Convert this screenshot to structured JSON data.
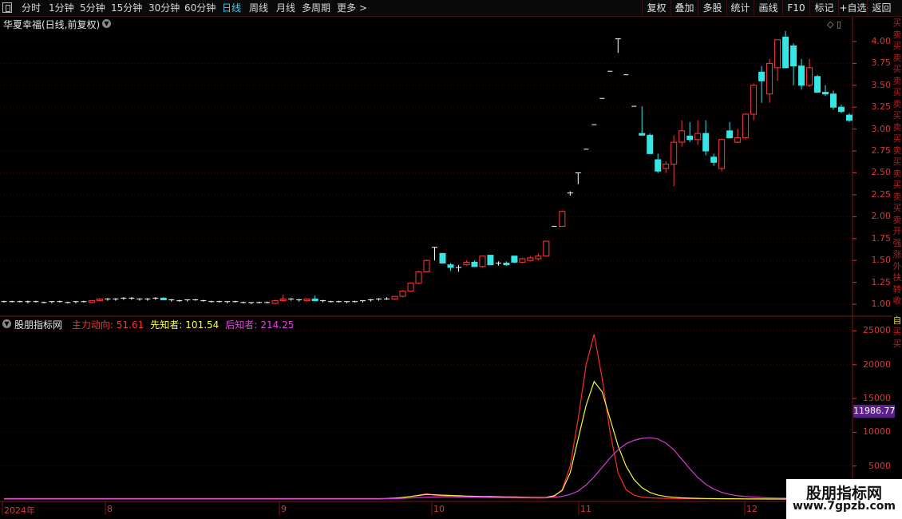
{
  "toolbar": {
    "periods": [
      "分时",
      "1分钟",
      "5分钟",
      "15分钟",
      "30分钟",
      "60分钟",
      "日线",
      "周线",
      "月线",
      "多周期",
      "更多 >"
    ],
    "active_period": "日线",
    "right_buttons": [
      "复权",
      "叠加",
      "多股",
      "统计",
      "画线",
      "F10",
      "标记",
      "+自选",
      "返回"
    ]
  },
  "stock": {
    "title": "华夏幸福(日线,前复权)"
  },
  "price_axis": {
    "ticks": [
      "4.00",
      "3.75",
      "3.50",
      "3.25",
      "3.00",
      "2.75",
      "2.50",
      "2.25",
      "2.00",
      "1.75",
      "1.50",
      "1.25",
      "1.00"
    ]
  },
  "indicator": {
    "name": "股朋指标网",
    "lines": [
      {
        "label": "主力动向:",
        "value": "51.61",
        "color": "#ff3030"
      },
      {
        "label": "先知者:",
        "value": "101.54",
        "color": "#ffff40"
      },
      {
        "label": "后知者:",
        "value": "214.25",
        "color": "#e040e0"
      }
    ],
    "axis_ticks": [
      "25000",
      "20000",
      "15000",
      "10000",
      "5000"
    ],
    "current_value": "11986.77"
  },
  "x_axis": {
    "labels": [
      "2024年",
      "8",
      "9",
      "10",
      "11",
      "12"
    ]
  },
  "right_strip": {
    "chars": "买卖买卖买卖买卖买卖买卖买卖买卖买卖开强涨外扶转收",
    "chars2": "自买买"
  },
  "watermark": {
    "title": "股朋指标网",
    "url": "www.7gpzb.com"
  },
  "colors": {
    "up": "#ff3b3b",
    "down": "#35e6e6",
    "grid": "#3a1010",
    "axis": "#d63a3a"
  },
  "chart_data": {
    "type": "candlestick",
    "title": "华夏幸福(日线,前复权)",
    "ylim": [
      0.9,
      4.2
    ],
    "ohlc": [
      [
        1.03,
        1.04,
        1.02,
        1.03
      ],
      [
        1.03,
        1.04,
        1.02,
        1.03
      ],
      [
        1.03,
        1.04,
        1.02,
        1.02
      ],
      [
        1.02,
        1.04,
        1.01,
        1.03
      ],
      [
        1.03,
        1.04,
        1.02,
        1.02
      ],
      [
        1.02,
        1.03,
        1.01,
        1.02
      ],
      [
        1.02,
        1.03,
        1.01,
        1.03
      ],
      [
        1.03,
        1.04,
        1.02,
        1.02
      ],
      [
        1.02,
        1.03,
        1.01,
        1.02
      ],
      [
        1.02,
        1.03,
        1.01,
        1.03
      ],
      [
        1.03,
        1.04,
        1.02,
        1.02
      ],
      [
        1.02,
        1.04,
        1.01,
        1.04
      ],
      [
        1.04,
        1.06,
        1.03,
        1.06
      ],
      [
        1.06,
        1.07,
        1.04,
        1.05
      ],
      [
        1.05,
        1.07,
        1.04,
        1.06
      ],
      [
        1.06,
        1.08,
        1.05,
        1.07
      ],
      [
        1.07,
        1.08,
        1.05,
        1.06
      ],
      [
        1.06,
        1.07,
        1.04,
        1.05
      ],
      [
        1.05,
        1.07,
        1.04,
        1.06
      ],
      [
        1.06,
        1.08,
        1.05,
        1.07
      ],
      [
        1.07,
        1.08,
        1.05,
        1.05
      ],
      [
        1.05,
        1.06,
        1.03,
        1.04
      ],
      [
        1.04,
        1.05,
        1.03,
        1.04
      ],
      [
        1.04,
        1.05,
        1.03,
        1.05
      ],
      [
        1.05,
        1.06,
        1.04,
        1.04
      ],
      [
        1.04,
        1.05,
        1.03,
        1.03
      ],
      [
        1.03,
        1.04,
        1.02,
        1.03
      ],
      [
        1.03,
        1.04,
        1.02,
        1.02
      ],
      [
        1.02,
        1.03,
        1.01,
        1.03
      ],
      [
        1.03,
        1.04,
        1.02,
        1.02
      ],
      [
        1.02,
        1.03,
        1.01,
        1.01
      ],
      [
        1.01,
        1.02,
        1.0,
        1.02
      ],
      [
        1.02,
        1.03,
        1.01,
        1.02
      ],
      [
        1.02,
        1.03,
        1.01,
        1.01
      ],
      [
        1.01,
        1.05,
        1.0,
        1.04
      ],
      [
        1.04,
        1.11,
        1.03,
        1.06
      ],
      [
        1.06,
        1.07,
        1.04,
        1.05
      ],
      [
        1.05,
        1.06,
        1.03,
        1.04
      ],
      [
        1.04,
        1.06,
        1.03,
        1.06
      ],
      [
        1.06,
        1.1,
        1.04,
        1.04
      ],
      [
        1.04,
        1.05,
        1.02,
        1.03
      ],
      [
        1.03,
        1.04,
        1.02,
        1.03
      ],
      [
        1.03,
        1.04,
        1.02,
        1.02
      ],
      [
        1.02,
        1.03,
        1.01,
        1.03
      ],
      [
        1.03,
        1.04,
        1.02,
        1.03
      ],
      [
        1.03,
        1.04,
        1.02,
        1.04
      ],
      [
        1.04,
        1.06,
        1.03,
        1.05
      ],
      [
        1.05,
        1.07,
        1.04,
        1.06
      ],
      [
        1.06,
        1.08,
        1.05,
        1.06
      ],
      [
        1.06,
        1.09,
        1.05,
        1.09
      ],
      [
        1.09,
        1.16,
        1.08,
        1.15
      ],
      [
        1.15,
        1.25,
        1.14,
        1.24
      ],
      [
        1.24,
        1.38,
        1.23,
        1.37
      ],
      [
        1.37,
        1.51,
        1.36,
        1.5
      ],
      [
        1.65,
        1.65,
        1.5,
        1.65
      ],
      [
        1.58,
        1.58,
        1.47,
        1.47
      ],
      [
        1.45,
        1.47,
        1.38,
        1.42
      ],
      [
        1.42,
        1.45,
        1.37,
        1.42
      ],
      [
        1.45,
        1.5,
        1.44,
        1.48
      ],
      [
        1.48,
        1.5,
        1.43,
        1.43
      ],
      [
        1.43,
        1.55,
        1.42,
        1.55
      ],
      [
        1.56,
        1.56,
        1.45,
        1.45
      ],
      [
        1.46,
        1.49,
        1.44,
        1.47
      ],
      [
        1.47,
        1.49,
        1.44,
        1.45
      ],
      [
        1.55,
        1.55,
        1.47,
        1.48
      ],
      [
        1.48,
        1.53,
        1.47,
        1.52
      ],
      [
        1.5,
        1.55,
        1.49,
        1.53
      ],
      [
        1.52,
        1.58,
        1.5,
        1.55
      ],
      [
        1.55,
        1.72,
        1.54,
        1.72
      ],
      [
        1.89,
        1.89,
        1.88,
        1.89
      ],
      [
        1.89,
        2.07,
        1.89,
        2.06
      ],
      [
        2.27,
        2.29,
        2.24,
        2.27
      ],
      [
        2.5,
        2.5,
        2.37,
        2.49
      ],
      [
        2.77,
        2.77,
        2.76,
        2.77
      ],
      [
        3.05,
        3.05,
        3.04,
        3.05
      ],
      [
        3.35,
        3.35,
        3.34,
        3.35
      ],
      [
        3.66,
        3.66,
        3.65,
        3.66
      ],
      [
        4.03,
        4.03,
        3.87,
        4.03
      ],
      [
        3.63,
        3.63,
        3.62,
        3.62
      ],
      [
        3.26,
        3.26,
        3.25,
        3.26
      ],
      [
        2.95,
        3.26,
        2.93,
        2.93
      ],
      [
        2.93,
        2.95,
        2.72,
        2.72
      ],
      [
        2.65,
        2.72,
        2.5,
        2.52
      ],
      [
        2.55,
        2.63,
        2.5,
        2.6
      ],
      [
        2.6,
        2.93,
        2.35,
        2.85
      ],
      [
        2.85,
        3.1,
        2.8,
        2.98
      ],
      [
        2.92,
        3.08,
        2.85,
        2.88
      ],
      [
        2.88,
        3.1,
        2.82,
        2.95
      ],
      [
        2.95,
        3.1,
        2.7,
        2.75
      ],
      [
        2.68,
        2.72,
        2.58,
        2.62
      ],
      [
        2.55,
        2.89,
        2.52,
        2.88
      ],
      [
        2.98,
        3.08,
        2.9,
        2.9
      ],
      [
        2.85,
        3.0,
        2.84,
        2.9
      ],
      [
        2.9,
        3.18,
        2.88,
        3.17
      ],
      [
        3.17,
        3.52,
        3.1,
        3.5
      ],
      [
        3.65,
        3.72,
        3.3,
        3.55
      ],
      [
        3.4,
        3.8,
        3.3,
        3.75
      ],
      [
        3.7,
        4.02,
        3.55,
        4.02
      ],
      [
        4.05,
        4.12,
        3.8,
        3.7
      ],
      [
        3.95,
        3.98,
        3.5,
        3.72
      ],
      [
        3.72,
        3.8,
        3.45,
        3.5
      ],
      [
        3.5,
        3.8,
        3.48,
        3.7
      ],
      [
        3.6,
        3.62,
        3.48,
        3.42
      ],
      [
        3.42,
        3.5,
        3.38,
        3.4
      ],
      [
        3.4,
        3.44,
        3.22,
        3.25
      ],
      [
        3.25,
        3.28,
        3.18,
        3.2
      ],
      [
        3.16,
        3.18,
        3.08,
        3.1
      ]
    ],
    "indicator_ylim": [
      0,
      26000
    ],
    "series": [
      {
        "name": "主力动向",
        "values": [
          120,
          120,
          120,
          120,
          120,
          120,
          120,
          120,
          120,
          120,
          120,
          120,
          120,
          120,
          120,
          120,
          120,
          120,
          120,
          120,
          120,
          120,
          120,
          120,
          120,
          120,
          120,
          120,
          120,
          120,
          120,
          120,
          120,
          120,
          120,
          120,
          120,
          120,
          120,
          120,
          120,
          120,
          120,
          120,
          120,
          120,
          120,
          120,
          150,
          200,
          300,
          500,
          700,
          900,
          700,
          600,
          500,
          450,
          400,
          380,
          360,
          340,
          320,
          300,
          290,
          280,
          270,
          260,
          280,
          500,
          1500,
          5000,
          12000,
          20000,
          24500,
          18000,
          10000,
          4000,
          1500,
          700,
          400,
          300,
          250,
          220,
          200,
          190,
          180,
          170,
          160,
          150,
          140,
          130,
          125,
          120,
          118,
          115,
          112,
          110,
          108,
          105,
          102,
          100,
          98,
          96,
          94,
          92
        ]
      },
      {
        "name": "先知者",
        "values": [
          180,
          180,
          180,
          180,
          180,
          180,
          180,
          180,
          180,
          180,
          180,
          180,
          180,
          180,
          180,
          180,
          180,
          180,
          180,
          180,
          180,
          180,
          180,
          180,
          180,
          180,
          180,
          180,
          180,
          180,
          180,
          180,
          180,
          180,
          180,
          180,
          180,
          180,
          180,
          180,
          180,
          180,
          180,
          180,
          180,
          180,
          180,
          180,
          200,
          250,
          350,
          500,
          650,
          800,
          750,
          700,
          650,
          600,
          560,
          520,
          500,
          480,
          460,
          440,
          420,
          400,
          380,
          360,
          380,
          600,
          1400,
          4000,
          9000,
          14000,
          17500,
          16000,
          12000,
          8000,
          5000,
          3000,
          1800,
          1100,
          700,
          500,
          380,
          300,
          250,
          220,
          200,
          180,
          170,
          160,
          150,
          145,
          140,
          135,
          130,
          125,
          120,
          115,
          110,
          108,
          105,
          103,
          102
        ]
      },
      {
        "name": "后知者",
        "values": [
          150,
          150,
          150,
          150,
          150,
          150,
          150,
          150,
          150,
          150,
          150,
          150,
          150,
          150,
          150,
          150,
          150,
          150,
          150,
          150,
          150,
          150,
          150,
          150,
          150,
          150,
          150,
          150,
          150,
          150,
          150,
          150,
          150,
          150,
          150,
          150,
          150,
          150,
          150,
          150,
          150,
          150,
          150,
          150,
          150,
          150,
          150,
          150,
          160,
          180,
          220,
          280,
          340,
          400,
          430,
          440,
          440,
          430,
          420,
          410,
          400,
          390,
          380,
          370,
          360,
          350,
          340,
          330,
          330,
          380,
          520,
          800,
          1300,
          2200,
          3400,
          4800,
          6200,
          7400,
          8300,
          8800,
          9100,
          9200,
          9000,
          8400,
          7400,
          6000,
          4600,
          3300,
          2300,
          1600,
          1100,
          800,
          600,
          480,
          400,
          340,
          300,
          270,
          250,
          235,
          225,
          220,
          218,
          216,
          215
        ]
      }
    ]
  }
}
